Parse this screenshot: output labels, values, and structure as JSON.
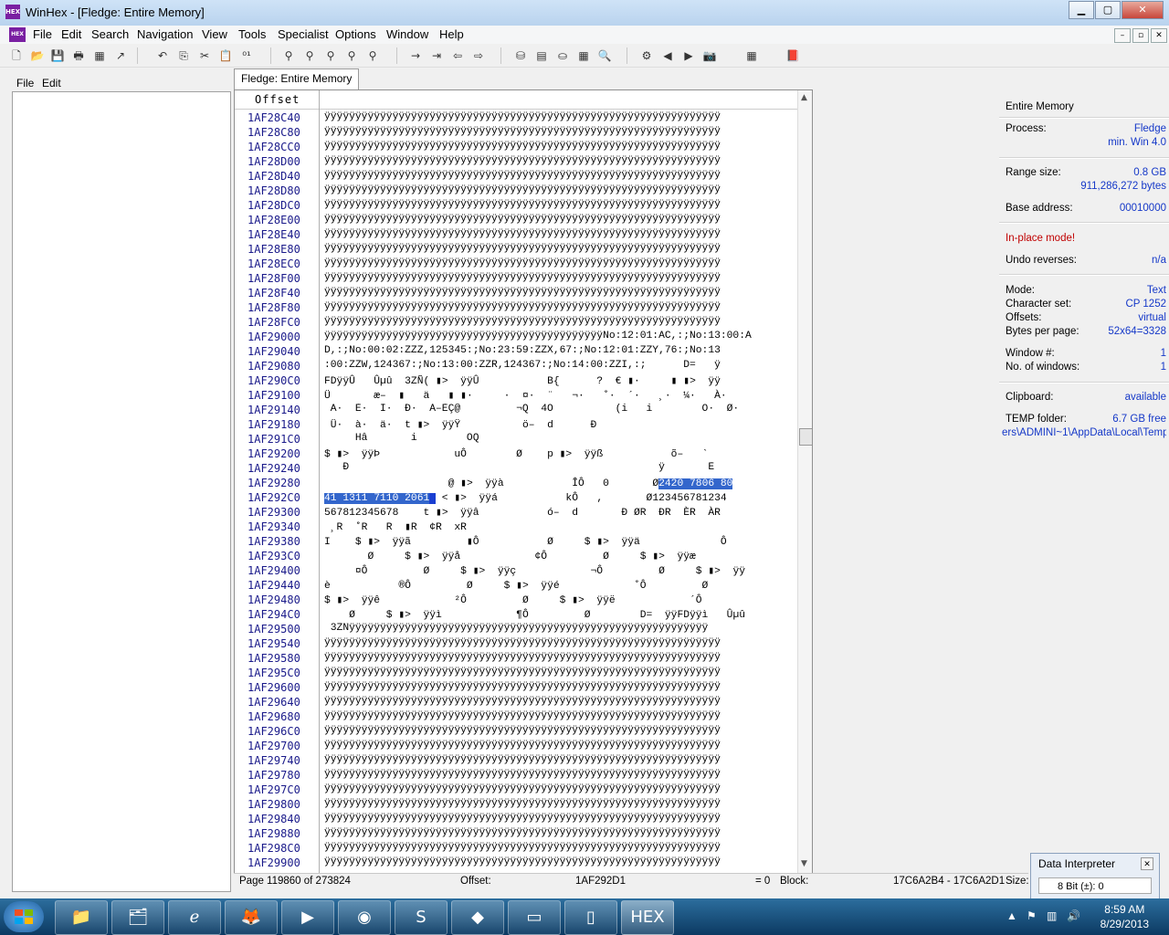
{
  "window": {
    "title": "WinHex - [Fledge: Entire Memory]",
    "app_icon_text": "HEX",
    "min_btn": "▁",
    "max_btn": "▢",
    "close_btn": "✕"
  },
  "menu": [
    "File",
    "Edit",
    "Search",
    "Navigation",
    "View",
    "Tools",
    "Specialist",
    "Options",
    "Window",
    "Help"
  ],
  "mdi_buttons": [
    "–",
    "▫",
    "✕"
  ],
  "left_panel": {
    "menu": [
      "File",
      "Edit"
    ]
  },
  "tab": {
    "label": "Fledge: Entire Memory"
  },
  "hex": {
    "offset_header": "Offset",
    "rows": [
      {
        "offset": "1AF28C40",
        "text": "ÿÿÿÿÿÿÿÿÿÿÿÿÿÿÿÿÿÿÿÿÿÿÿÿÿÿÿÿÿÿÿÿÿÿÿÿÿÿÿÿÿÿÿÿÿÿÿÿÿÿÿÿÿÿÿÿÿÿÿÿÿÿÿÿ"
      },
      {
        "offset": "1AF28C80",
        "text": "ÿÿÿÿÿÿÿÿÿÿÿÿÿÿÿÿÿÿÿÿÿÿÿÿÿÿÿÿÿÿÿÿÿÿÿÿÿÿÿÿÿÿÿÿÿÿÿÿÿÿÿÿÿÿÿÿÿÿÿÿÿÿÿÿ"
      },
      {
        "offset": "1AF28CC0",
        "text": "ÿÿÿÿÿÿÿÿÿÿÿÿÿÿÿÿÿÿÿÿÿÿÿÿÿÿÿÿÿÿÿÿÿÿÿÿÿÿÿÿÿÿÿÿÿÿÿÿÿÿÿÿÿÿÿÿÿÿÿÿÿÿÿÿ"
      },
      {
        "offset": "1AF28D00",
        "text": "ÿÿÿÿÿÿÿÿÿÿÿÿÿÿÿÿÿÿÿÿÿÿÿÿÿÿÿÿÿÿÿÿÿÿÿÿÿÿÿÿÿÿÿÿÿÿÿÿÿÿÿÿÿÿÿÿÿÿÿÿÿÿÿÿ"
      },
      {
        "offset": "1AF28D40",
        "text": "ÿÿÿÿÿÿÿÿÿÿÿÿÿÿÿÿÿÿÿÿÿÿÿÿÿÿÿÿÿÿÿÿÿÿÿÿÿÿÿÿÿÿÿÿÿÿÿÿÿÿÿÿÿÿÿÿÿÿÿÿÿÿÿÿ"
      },
      {
        "offset": "1AF28D80",
        "text": "ÿÿÿÿÿÿÿÿÿÿÿÿÿÿÿÿÿÿÿÿÿÿÿÿÿÿÿÿÿÿÿÿÿÿÿÿÿÿÿÿÿÿÿÿÿÿÿÿÿÿÿÿÿÿÿÿÿÿÿÿÿÿÿÿ"
      },
      {
        "offset": "1AF28DC0",
        "text": "ÿÿÿÿÿÿÿÿÿÿÿÿÿÿÿÿÿÿÿÿÿÿÿÿÿÿÿÿÿÿÿÿÿÿÿÿÿÿÿÿÿÿÿÿÿÿÿÿÿÿÿÿÿÿÿÿÿÿÿÿÿÿÿÿ"
      },
      {
        "offset": "1AF28E00",
        "text": "ÿÿÿÿÿÿÿÿÿÿÿÿÿÿÿÿÿÿÿÿÿÿÿÿÿÿÿÿÿÿÿÿÿÿÿÿÿÿÿÿÿÿÿÿÿÿÿÿÿÿÿÿÿÿÿÿÿÿÿÿÿÿÿÿ"
      },
      {
        "offset": "1AF28E40",
        "text": "ÿÿÿÿÿÿÿÿÿÿÿÿÿÿÿÿÿÿÿÿÿÿÿÿÿÿÿÿÿÿÿÿÿÿÿÿÿÿÿÿÿÿÿÿÿÿÿÿÿÿÿÿÿÿÿÿÿÿÿÿÿÿÿÿ"
      },
      {
        "offset": "1AF28E80",
        "text": "ÿÿÿÿÿÿÿÿÿÿÿÿÿÿÿÿÿÿÿÿÿÿÿÿÿÿÿÿÿÿÿÿÿÿÿÿÿÿÿÿÿÿÿÿÿÿÿÿÿÿÿÿÿÿÿÿÿÿÿÿÿÿÿÿ"
      },
      {
        "offset": "1AF28EC0",
        "text": "ÿÿÿÿÿÿÿÿÿÿÿÿÿÿÿÿÿÿÿÿÿÿÿÿÿÿÿÿÿÿÿÿÿÿÿÿÿÿÿÿÿÿÿÿÿÿÿÿÿÿÿÿÿÿÿÿÿÿÿÿÿÿÿÿ"
      },
      {
        "offset": "1AF28F00",
        "text": "ÿÿÿÿÿÿÿÿÿÿÿÿÿÿÿÿÿÿÿÿÿÿÿÿÿÿÿÿÿÿÿÿÿÿÿÿÿÿÿÿÿÿÿÿÿÿÿÿÿÿÿÿÿÿÿÿÿÿÿÿÿÿÿÿ"
      },
      {
        "offset": "1AF28F40",
        "text": "ÿÿÿÿÿÿÿÿÿÿÿÿÿÿÿÿÿÿÿÿÿÿÿÿÿÿÿÿÿÿÿÿÿÿÿÿÿÿÿÿÿÿÿÿÿÿÿÿÿÿÿÿÿÿÿÿÿÿÿÿÿÿÿÿ"
      },
      {
        "offset": "1AF28F80",
        "text": "ÿÿÿÿÿÿÿÿÿÿÿÿÿÿÿÿÿÿÿÿÿÿÿÿÿÿÿÿÿÿÿÿÿÿÿÿÿÿÿÿÿÿÿÿÿÿÿÿÿÿÿÿÿÿÿÿÿÿÿÿÿÿÿÿ"
      },
      {
        "offset": "1AF28FC0",
        "text": "ÿÿÿÿÿÿÿÿÿÿÿÿÿÿÿÿÿÿÿÿÿÿÿÿÿÿÿÿÿÿÿÿÿÿÿÿÿÿÿÿÿÿÿÿÿÿÿÿÿÿÿÿÿÿÿÿÿÿÿÿÿÿÿÿ"
      },
      {
        "offset": "1AF29000",
        "text": "ÿÿÿÿÿÿÿÿÿÿÿÿÿÿÿÿÿÿÿÿÿÿÿÿÿÿÿÿÿÿÿÿÿÿÿÿÿÿÿÿÿÿÿÿÿNo:12:01:AC,:;No:13:00:A"
      },
      {
        "offset": "1AF29040",
        "text": "D,:;No:00:02:ZZZ,125345:;No:23:59:ZZX,67:;No:12:01:ZZY,76:;No:13"
      },
      {
        "offset": "1AF29080",
        "text": ":00:ZZW,124367:;No:13:00:ZZR,124367:;No:14:00:ZZI,:;      D=   ÿ"
      },
      {
        "offset": "1AF290C0",
        "text": "FDÿÿÛ   Ûµû  3ZÑ( ▮>  ÿÿÛ           B{      ?  € ▮·     ▮ ▮>  ÿÿ"
      },
      {
        "offset": "1AF29100",
        "text": "Ü       æ–  ▮   ä   ▮ ▮·     ·  ¤·  ¨   ¬·   ˚·  ´·   ¸·  ¼·   À·"
      },
      {
        "offset": "1AF29140",
        "text": " Ä·  È·  Ì·  Ð·  À–ÈÇ@         ¬Q  4O          (i   i        Ò·  Ø·"
      },
      {
        "offset": "1AF29180",
        "text": " Ü·  à·  ä·  t ▮>  ÿÿŸ          ö–  d      Ð"
      },
      {
        "offset": "1AF291C0",
        "text": "     Hâ       i        ÔQ"
      },
      {
        "offset": "1AF29200",
        "text": "$ ▮>  ÿÿÞ            uÔ        Ø    p ▮>  ÿÿß           õ–   `"
      },
      {
        "offset": "1AF29240",
        "text": "   Ð                                                  ÿ       È"
      },
      {
        "offset": "1AF29280",
        "text": "                    @ ▮>  ÿÿà           ÎÔ   0       Ø2420 7806 80"
      },
      {
        "offset": "1AF292C0",
        "text": "41 1311 7110 2061  < ▮>  ÿÿá           kÔ   ,       Ø123456781234"
      },
      {
        "offset": "1AF29300",
        "text": "567812345678    t ▮>  ÿÿâ           ó–  d       Ð ØR  ÐR  ÈR  ÀR"
      },
      {
        "offset": "1AF29340",
        "text": " ¸R  ˚R   R  ▮R  ¢R  xR"
      },
      {
        "offset": "1AF29380",
        "text": "I    $ ▮>  ÿÿã         ▮Ô           Ø     $ ▮>  ÿÿä             Ô"
      },
      {
        "offset": "1AF293C0",
        "text": "       Ø     $ ▮>  ÿÿå            ¢Ô         Ø     $ ▮>  ÿÿæ"
      },
      {
        "offset": "1AF29400",
        "text": "     ¤Ô         Ø     $ ▮>  ÿÿç            ¬Ô         Ø     $ ▮>  ÿÿ"
      },
      {
        "offset": "1AF29440",
        "text": "è           ®Ô         Ø     $ ▮>  ÿÿé            ˚Ô         Ø"
      },
      {
        "offset": "1AF29480",
        "text": "$ ▮>  ÿÿê            ²Ô         Ø     $ ▮>  ÿÿë            ´Ô"
      },
      {
        "offset": "1AF294C0",
        "text": "    Ø     $ ▮>  ÿÿì            ¶Ô         Ø        D=  ÿÿFDÿÿì   Ûµû"
      },
      {
        "offset": "1AF29500",
        "text": " 3ZÑÿÿÿÿÿÿÿÿÿÿÿÿÿÿÿÿÿÿÿÿÿÿÿÿÿÿÿÿÿÿÿÿÿÿÿÿÿÿÿÿÿÿÿÿÿÿÿÿÿÿÿÿÿÿÿÿÿÿ"
      },
      {
        "offset": "1AF29540",
        "text": "ÿÿÿÿÿÿÿÿÿÿÿÿÿÿÿÿÿÿÿÿÿÿÿÿÿÿÿÿÿÿÿÿÿÿÿÿÿÿÿÿÿÿÿÿÿÿÿÿÿÿÿÿÿÿÿÿÿÿÿÿÿÿÿÿ"
      },
      {
        "offset": "1AF29580",
        "text": "ÿÿÿÿÿÿÿÿÿÿÿÿÿÿÿÿÿÿÿÿÿÿÿÿÿÿÿÿÿÿÿÿÿÿÿÿÿÿÿÿÿÿÿÿÿÿÿÿÿÿÿÿÿÿÿÿÿÿÿÿÿÿÿÿ"
      },
      {
        "offset": "1AF295C0",
        "text": "ÿÿÿÿÿÿÿÿÿÿÿÿÿÿÿÿÿÿÿÿÿÿÿÿÿÿÿÿÿÿÿÿÿÿÿÿÿÿÿÿÿÿÿÿÿÿÿÿÿÿÿÿÿÿÿÿÿÿÿÿÿÿÿÿ"
      },
      {
        "offset": "1AF29600",
        "text": "ÿÿÿÿÿÿÿÿÿÿÿÿÿÿÿÿÿÿÿÿÿÿÿÿÿÿÿÿÿÿÿÿÿÿÿÿÿÿÿÿÿÿÿÿÿÿÿÿÿÿÿÿÿÿÿÿÿÿÿÿÿÿÿÿ"
      },
      {
        "offset": "1AF29640",
        "text": "ÿÿÿÿÿÿÿÿÿÿÿÿÿÿÿÿÿÿÿÿÿÿÿÿÿÿÿÿÿÿÿÿÿÿÿÿÿÿÿÿÿÿÿÿÿÿÿÿÿÿÿÿÿÿÿÿÿÿÿÿÿÿÿÿ"
      },
      {
        "offset": "1AF29680",
        "text": "ÿÿÿÿÿÿÿÿÿÿÿÿÿÿÿÿÿÿÿÿÿÿÿÿÿÿÿÿÿÿÿÿÿÿÿÿÿÿÿÿÿÿÿÿÿÿÿÿÿÿÿÿÿÿÿÿÿÿÿÿÿÿÿÿ"
      },
      {
        "offset": "1AF296C0",
        "text": "ÿÿÿÿÿÿÿÿÿÿÿÿÿÿÿÿÿÿÿÿÿÿÿÿÿÿÿÿÿÿÿÿÿÿÿÿÿÿÿÿÿÿÿÿÿÿÿÿÿÿÿÿÿÿÿÿÿÿÿÿÿÿÿÿ"
      },
      {
        "offset": "1AF29700",
        "text": "ÿÿÿÿÿÿÿÿÿÿÿÿÿÿÿÿÿÿÿÿÿÿÿÿÿÿÿÿÿÿÿÿÿÿÿÿÿÿÿÿÿÿÿÿÿÿÿÿÿÿÿÿÿÿÿÿÿÿÿÿÿÿÿÿ"
      },
      {
        "offset": "1AF29740",
        "text": "ÿÿÿÿÿÿÿÿÿÿÿÿÿÿÿÿÿÿÿÿÿÿÿÿÿÿÿÿÿÿÿÿÿÿÿÿÿÿÿÿÿÿÿÿÿÿÿÿÿÿÿÿÿÿÿÿÿÿÿÿÿÿÿÿ"
      },
      {
        "offset": "1AF29780",
        "text": "ÿÿÿÿÿÿÿÿÿÿÿÿÿÿÿÿÿÿÿÿÿÿÿÿÿÿÿÿÿÿÿÿÿÿÿÿÿÿÿÿÿÿÿÿÿÿÿÿÿÿÿÿÿÿÿÿÿÿÿÿÿÿÿÿ"
      },
      {
        "offset": "1AF297C0",
        "text": "ÿÿÿÿÿÿÿÿÿÿÿÿÿÿÿÿÿÿÿÿÿÿÿÿÿÿÿÿÿÿÿÿÿÿÿÿÿÿÿÿÿÿÿÿÿÿÿÿÿÿÿÿÿÿÿÿÿÿÿÿÿÿÿÿ"
      },
      {
        "offset": "1AF29800",
        "text": "ÿÿÿÿÿÿÿÿÿÿÿÿÿÿÿÿÿÿÿÿÿÿÿÿÿÿÿÿÿÿÿÿÿÿÿÿÿÿÿÿÿÿÿÿÿÿÿÿÿÿÿÿÿÿÿÿÿÿÿÿÿÿÿÿ"
      },
      {
        "offset": "1AF29840",
        "text": "ÿÿÿÿÿÿÿÿÿÿÿÿÿÿÿÿÿÿÿÿÿÿÿÿÿÿÿÿÿÿÿÿÿÿÿÿÿÿÿÿÿÿÿÿÿÿÿÿÿÿÿÿÿÿÿÿÿÿÿÿÿÿÿÿ"
      },
      {
        "offset": "1AF29880",
        "text": "ÿÿÿÿÿÿÿÿÿÿÿÿÿÿÿÿÿÿÿÿÿÿÿÿÿÿÿÿÿÿÿÿÿÿÿÿÿÿÿÿÿÿÿÿÿÿÿÿÿÿÿÿÿÿÿÿÿÿÿÿÿÿÿÿ"
      },
      {
        "offset": "1AF298C0",
        "text": "ÿÿÿÿÿÿÿÿÿÿÿÿÿÿÿÿÿÿÿÿÿÿÿÿÿÿÿÿÿÿÿÿÿÿÿÿÿÿÿÿÿÿÿÿÿÿÿÿÿÿÿÿÿÿÿÿÿÿÿÿÿÿÿÿ"
      },
      {
        "offset": "1AF29900",
        "text": "ÿÿÿÿÿÿÿÿÿÿÿÿÿÿÿÿÿÿÿÿÿÿÿÿÿÿÿÿÿÿÿÿÿÿÿÿÿÿÿÿÿÿÿÿÿÿÿÿÿÿÿÿÿÿÿÿÿÿÿÿÿÿÿÿ"
      }
    ],
    "selection": {
      "row_index": 25,
      "selected_text_start": "2420 7806 80",
      "next_row_selected": "41 1311 7110 2061"
    }
  },
  "info": {
    "title": "Entire Memory",
    "process_label": "Process:",
    "process_value": "Fledge",
    "process_sub": "min. Win 4.0",
    "range_label": "Range size:",
    "range_value": "0.8 GB",
    "range_bytes": "911,286,272 bytes",
    "base_label": "Base address:",
    "base_value": "00010000",
    "inplace": "In-place mode!",
    "undo_label": "Undo reverses:",
    "undo_value": "n/a",
    "mode_label": "Mode:",
    "mode_value": "Text",
    "charset_label": "Character set:",
    "charset_value": "CP 1252",
    "offsets_label": "Offsets:",
    "offsets_value": "virtual",
    "bpp_label": "Bytes per page:",
    "bpp_value": "52x64=3328",
    "window_label": "Window #:",
    "window_value": "1",
    "nwin_label": "No. of windows:",
    "nwin_value": "1",
    "clipboard_label": "Clipboard:",
    "clipboard_value": "available",
    "temp_label": "TEMP folder:",
    "temp_value": "6.7 GB free",
    "temp_path": "ers\\ADMINI~1\\AppData\\Local\\Temp"
  },
  "status": {
    "page": "Page 119860 of 273824",
    "offset_label": "Offset:",
    "offset_value": "1AF292D1",
    "eq": "= 0",
    "block_label": "Block:",
    "block_value": "17C6A2B4 - 17C6A2D1",
    "size_label": "Size:"
  },
  "data_interpreter": {
    "title": "Data Interpreter",
    "close": "✕",
    "value": "8 Bit (±): 0"
  },
  "taskbar": {
    "clock_time": "8:59 AM",
    "clock_date": "8/29/2013",
    "tasks": [
      "explorer",
      "files",
      "ie",
      "firefox",
      "media",
      "chrome",
      "skype",
      "app",
      "cmd",
      "device",
      "winhex"
    ]
  },
  "colors": {
    "selection": "#3366cc",
    "info_value": "#1538c8",
    "inplace": "#c00000",
    "offset_text": "#1a1a8a"
  }
}
